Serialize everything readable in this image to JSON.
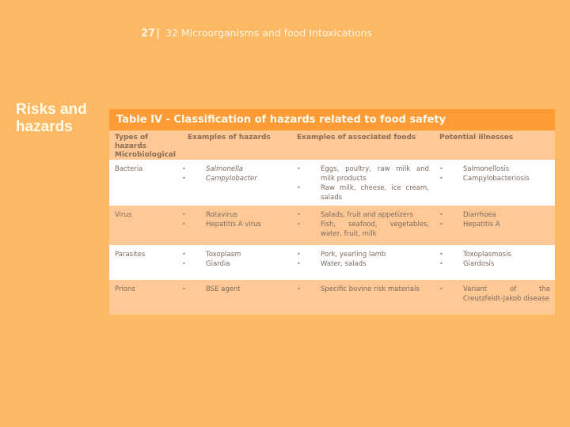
{
  "header": {
    "page_number": "27",
    "separator": "|",
    "chapter_title": "32 Microorganisms and food Intoxications"
  },
  "section_title": "Risks and hazards",
  "table": {
    "caption": "Table IV - Classification of hazards related to food safety",
    "columns": [
      "Types of hazards Microbiological",
      "Examples of hazards",
      "Examples of associated foods",
      "Potential illnesses"
    ],
    "rows": [
      {
        "type": "Bacteria",
        "hazards": [
          "Salmonella",
          "Campylobacter"
        ],
        "hazards_italic": true,
        "foods": [
          "Eggs, poultry, raw milk and milk products",
          "Raw milk, cheese, ice cream, salads"
        ],
        "illnesses": [
          "Salmonellosis",
          "Campylobacteriosis"
        ]
      },
      {
        "type": "Virus",
        "hazards": [
          "Rotavirus",
          "Hepatitis A virus"
        ],
        "hazards_italic": false,
        "foods": [
          "Salads, fruit and appetizers",
          "Fish, seafood, vegetables, water, fruit, milk"
        ],
        "illnesses": [
          "Diarrhoea",
          "Hepatitis A"
        ]
      },
      {
        "type": "Parasites",
        "hazards": [
          "Toxoplasm",
          "Giardia"
        ],
        "hazards_italic": false,
        "foods": [
          "Pork, yearling lamb",
          "Water, salads"
        ],
        "illnesses": [
          "Toxoplasmosis",
          "Giardosis"
        ]
      },
      {
        "type": "Prions",
        "hazards": [
          "BSE agent"
        ],
        "hazards_italic": false,
        "foods": [
          "Specific bovine risk materials"
        ],
        "illnesses": [
          "Variant of the Creutzfeldt-Jakob disease"
        ]
      }
    ],
    "bullet_glyph": "•"
  },
  "colors": {
    "background": "#fdb863",
    "caption_bar": "#fd9b35",
    "header_row": "#ffc895",
    "row_alt": "#ffffff"
  }
}
